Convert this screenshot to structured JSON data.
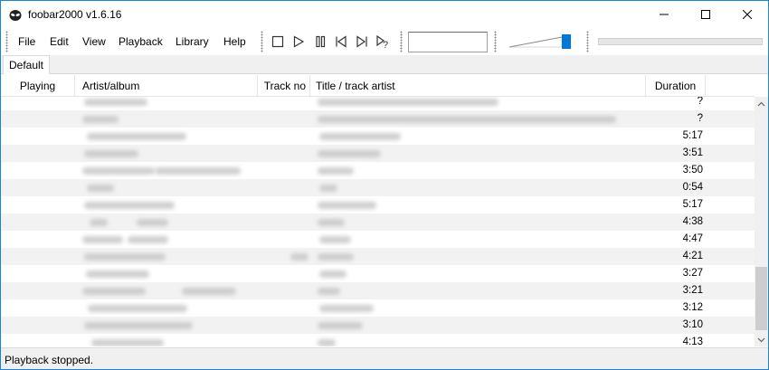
{
  "window": {
    "title": "foobar2000 v1.6.16"
  },
  "menu": {
    "items": [
      "File",
      "Edit",
      "View",
      "Playback",
      "Library",
      "Help"
    ]
  },
  "toolbar": {
    "buttons": [
      "stop-icon",
      "play-icon",
      "pause-icon",
      "previous-icon",
      "next-icon",
      "random-icon"
    ]
  },
  "tabs": [
    "Default"
  ],
  "playlist": {
    "columns": [
      "Playing",
      "Artist/album",
      "Track no",
      "Title / track artist",
      "Duration"
    ],
    "durations": [
      "?",
      "?",
      "5:17",
      "3:51",
      "3:50",
      "0:54",
      "5:17",
      "4:38",
      "4:47",
      "4:21",
      "3:27",
      "3:21",
      "3:12",
      "3:10",
      "4:13"
    ]
  },
  "status": {
    "text": "Playback stopped."
  },
  "colors": {
    "accent": "#1883d7",
    "volume_thumb": "#0078d7",
    "row_alt": "#f2f2f2"
  }
}
